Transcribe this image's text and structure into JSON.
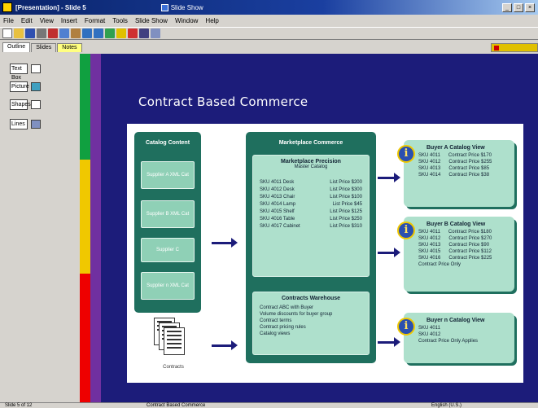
{
  "window": {
    "title": "[Presentation] - Slide 5",
    "doc_tab": "Slide Show",
    "controls": [
      "_",
      "□",
      "×"
    ]
  },
  "menubar": {
    "items": [
      "File",
      "Edit",
      "View",
      "Insert",
      "Format",
      "Tools",
      "Slide Show",
      "Window",
      "Help"
    ]
  },
  "toolbar": {
    "buttons": [
      "new-icon",
      "open-icon",
      "save-icon",
      "print-icon",
      "cut-icon",
      "copy-icon",
      "paste-icon",
      "undo-icon",
      "redo-icon",
      "chart-icon",
      "table-icon",
      "draw-icon",
      "zoom-icon",
      "help-icon"
    ]
  },
  "tabs": [
    "Outline",
    "Slides",
    "Notes"
  ],
  "left_panel": {
    "items": [
      {
        "label": "Text Box",
        "icon": "text-icon"
      },
      {
        "label": "Picture",
        "icon": "picture-icon"
      },
      {
        "label": "Shapes",
        "icon": "shapes-icon"
      },
      {
        "label": "Lines",
        "icon": "lines-icon"
      }
    ]
  },
  "slide": {
    "title": "Contract Based Commerce",
    "catalog": {
      "title": "Catalog Content",
      "tiles": [
        "Supplier A XML Cat",
        "Supplier B XML Cat",
        "Supplier C",
        "Supplier n XML Cat"
      ]
    },
    "marketplace": {
      "title": "Marketplace Commerce",
      "master_title": "Marketplace Precision",
      "master_sub": "Master Catalog",
      "rows": [
        {
          "sku": "SKU 4011 Desk",
          "price": "List Price $200"
        },
        {
          "sku": "SKU 4012 Desk",
          "price": "List Price $300"
        },
        {
          "sku": "SKU 4013 Chair",
          "price": "List Price $100"
        },
        {
          "sku": "SKU 4014 Lamp",
          "price": "List Price $45"
        },
        {
          "sku": "SKU 4015 Shelf",
          "price": "List Price $125"
        },
        {
          "sku": "SKU 4016 Table",
          "price": "List Price $250"
        },
        {
          "sku": "SKU 4017 Cabinet",
          "price": "List Price $310"
        }
      ],
      "contracts_title": "Contracts Warehouse",
      "contracts_items": [
        "Contract ABC with Buyer",
        "Volume discounts for buyer group",
        "Contract terms",
        "Contract pricing rules",
        "Catalog views"
      ]
    },
    "views": [
      {
        "title": "Buyer A Catalog View",
        "rows": [
          {
            "sku": "SKU 4011",
            "price": "Contract Price $170"
          },
          {
            "sku": "SKU 4012",
            "price": "Contract Price $255"
          },
          {
            "sku": "SKU 4013",
            "price": "Contract Price $85"
          },
          {
            "sku": "SKU 4014",
            "price": "Contract Price $38"
          }
        ]
      },
      {
        "title": "Buyer B Catalog View",
        "rows": [
          {
            "sku": "SKU 4011",
            "price": "Contract Price $180"
          },
          {
            "sku": "SKU 4012",
            "price": "Contract Price $270"
          },
          {
            "sku": "SKU 4013",
            "price": "Contract Price $90"
          },
          {
            "sku": "SKU 4015",
            "price": "Contract Price $112"
          },
          {
            "sku": "SKU 4016",
            "price": "Contract Price $225"
          }
        ],
        "footer": "Contract Price Only"
      },
      {
        "title": "Buyer n Catalog View",
        "lines": [
          "SKU 4011",
          "SKU 4012",
          "Contract Price Only Applies"
        ]
      }
    ],
    "doc_caption": "Contracts"
  },
  "statusbar": {
    "left": "Slide 5 of 12",
    "center": "Contract Based Commerce",
    "right": "English (U.S.)"
  }
}
